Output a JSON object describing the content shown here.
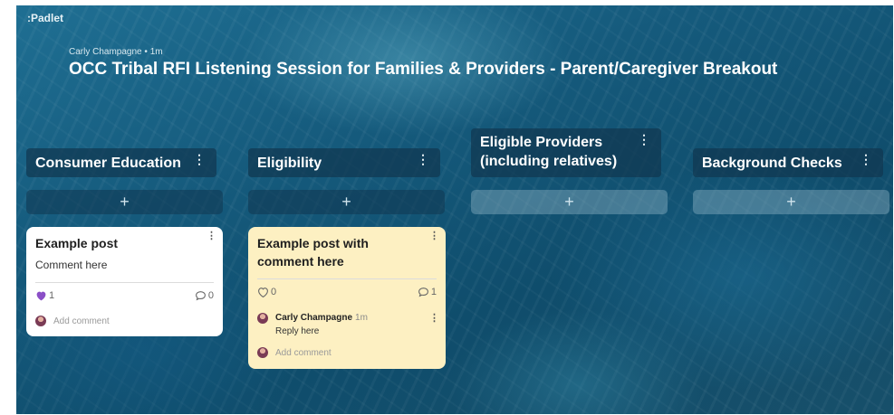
{
  "app": {
    "logo": ":Padlet"
  },
  "header": {
    "author": "Carly Champagne",
    "separator": "•",
    "time": "1m",
    "title": "OCC Tribal RFI Listening Session for Families & Providers - Parent/Caregiver Breakout"
  },
  "columns": [
    {
      "title": "Consumer Education"
    },
    {
      "title": "Eligibility"
    },
    {
      "title_line1": "Eligible Providers",
      "title_line2": "(including relatives)"
    },
    {
      "title": "Background Checks"
    }
  ],
  "add_post_glyph": "+",
  "kebab_glyph": "⋮",
  "posts": [
    {
      "title": "Example post",
      "body": "Comment here",
      "likes": "1",
      "comments": "0",
      "add_comment_placeholder": "Add comment"
    },
    {
      "title_line1": "Example post with",
      "title_line2": "comment here",
      "likes": "0",
      "comments": "1",
      "reply": {
        "author": "Carly Champagne",
        "time": "1m",
        "text": "Reply here"
      },
      "add_comment_placeholder": "Add comment"
    }
  ],
  "colors": {
    "like_filled": "#8b4fc7",
    "card_yellow": "#fdf0c2",
    "board_bg": "#155a7c"
  }
}
